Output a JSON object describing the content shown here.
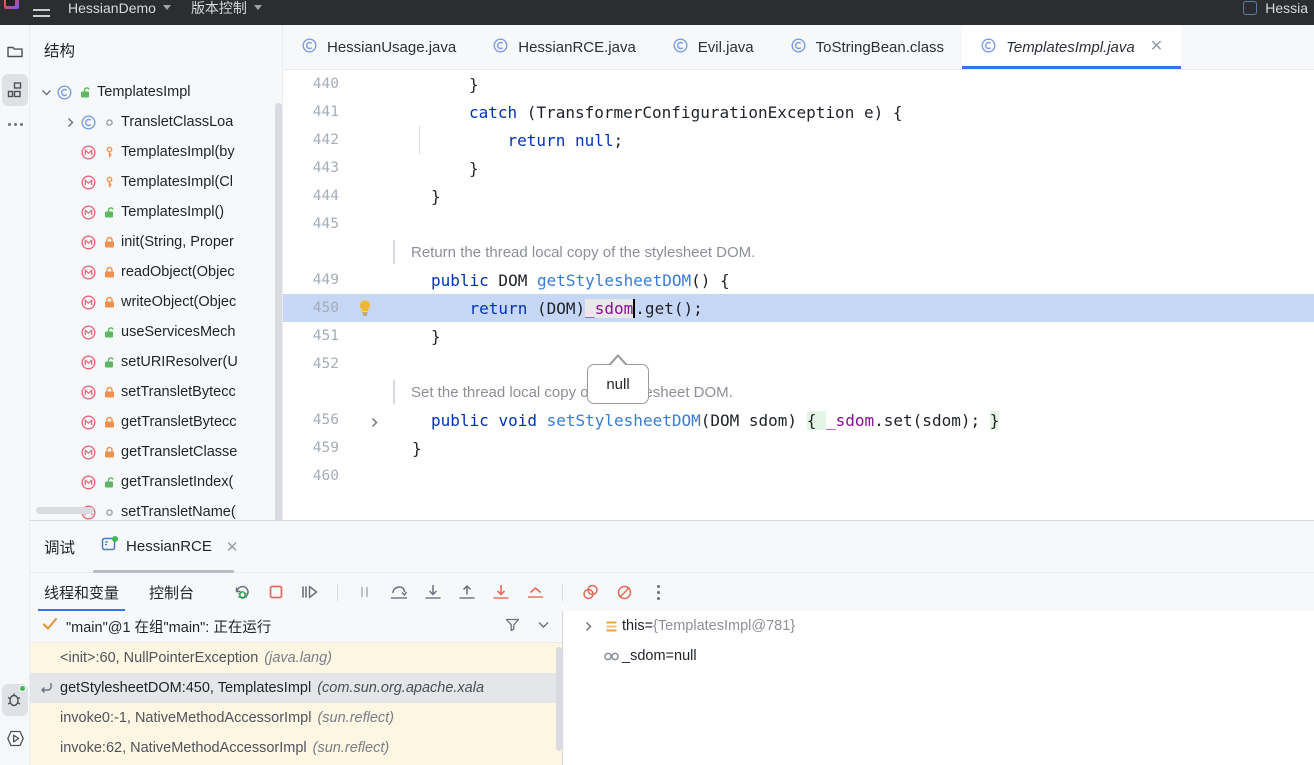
{
  "titlebar": {
    "menu_icon": "hamburger-menu-icon",
    "project_name": "HessianDemo",
    "vcs_label": "版本控制",
    "run_config": "Hessia"
  },
  "rail": {
    "project_icon": "folder-icon",
    "structure_icon": "structure-icon",
    "more_icon": "more-dots-icon",
    "debug_icon": "debug-bug-icon",
    "run_icon": "run-play-icon"
  },
  "structure": {
    "title": "结构",
    "items": [
      {
        "label": "TemplatesImpl",
        "kind": "class",
        "visibility": "public",
        "indent": 0,
        "expanded": true,
        "has_arrow": true
      },
      {
        "label": "TransletClassLoa",
        "kind": "class",
        "visibility": "package",
        "indent": 1,
        "expanded": false,
        "has_arrow": true
      },
      {
        "label": "TemplatesImpl(by",
        "kind": "method",
        "visibility": "protected",
        "indent": 1,
        "has_arrow": false
      },
      {
        "label": "TemplatesImpl(Cl",
        "kind": "method",
        "visibility": "protected",
        "indent": 1,
        "has_arrow": false
      },
      {
        "label": "TemplatesImpl()",
        "kind": "method",
        "visibility": "public",
        "indent": 1,
        "has_arrow": false
      },
      {
        "label": "init(String, Proper",
        "kind": "method",
        "visibility": "private",
        "indent": 1,
        "has_arrow": false
      },
      {
        "label": "readObject(Objec",
        "kind": "method",
        "visibility": "private",
        "indent": 1,
        "has_arrow": false
      },
      {
        "label": "writeObject(Objec",
        "kind": "method",
        "visibility": "private",
        "indent": 1,
        "has_arrow": false
      },
      {
        "label": "useServicesMech",
        "kind": "method",
        "visibility": "public",
        "indent": 1,
        "has_arrow": false
      },
      {
        "label": "setURIResolver(U",
        "kind": "method",
        "visibility": "public",
        "indent": 1,
        "has_arrow": false
      },
      {
        "label": "setTransletBytecc",
        "kind": "method",
        "visibility": "private",
        "indent": 1,
        "has_arrow": false
      },
      {
        "label": "getTransletBytecc",
        "kind": "method",
        "visibility": "private",
        "indent": 1,
        "has_arrow": false
      },
      {
        "label": "getTransletClasse",
        "kind": "method",
        "visibility": "private",
        "indent": 1,
        "has_arrow": false
      },
      {
        "label": "getTransletIndex(",
        "kind": "method",
        "visibility": "public",
        "indent": 1,
        "has_arrow": false
      },
      {
        "label": "setTransletName(",
        "kind": "method",
        "visibility": "package",
        "indent": 1,
        "has_arrow": false
      }
    ]
  },
  "editor_tabs": [
    {
      "label": "HessianUsage.java",
      "icon": "java-class-icon",
      "active": false,
      "closable": false
    },
    {
      "label": "HessianRCE.java",
      "icon": "java-class-icon",
      "active": false,
      "closable": false
    },
    {
      "label": "Evil.java",
      "icon": "java-class-icon",
      "active": false,
      "closable": false
    },
    {
      "label": "ToStringBean.class",
      "icon": "java-class-icon",
      "active": false,
      "closable": false
    },
    {
      "label": "TemplatesImpl.java",
      "icon": "java-class-icon",
      "active": true,
      "closable": true
    }
  ],
  "code": {
    "lines": [
      {
        "num": "440",
        "type": "code",
        "indent": 4,
        "tokens": [
          {
            "t": "}",
            "c": "plain"
          }
        ]
      },
      {
        "num": "441",
        "type": "code",
        "indent": 4,
        "tokens": [
          {
            "t": "catch",
            "c": "kw"
          },
          {
            "t": " (TransformerConfigurationException e) {",
            "c": "plain"
          }
        ]
      },
      {
        "num": "442",
        "type": "code",
        "indent": 4,
        "guide": true,
        "tokens": [
          {
            "t": "    ",
            "c": "plain"
          },
          {
            "t": "return",
            "c": "kw"
          },
          {
            "t": " ",
            "c": "plain"
          },
          {
            "t": "null",
            "c": "kw"
          },
          {
            "t": ";",
            "c": "plain"
          }
        ]
      },
      {
        "num": "443",
        "type": "code",
        "indent": 4,
        "tokens": [
          {
            "t": "}",
            "c": "plain"
          }
        ]
      },
      {
        "num": "444",
        "type": "code",
        "indent": 2,
        "tokens": [
          {
            "t": "}",
            "c": "plain"
          }
        ]
      },
      {
        "num": "445",
        "type": "code",
        "indent": 0,
        "tokens": []
      },
      {
        "num": "",
        "type": "doc",
        "text": "Return the thread local copy of the stylesheet DOM."
      },
      {
        "num": "449",
        "type": "code",
        "indent": 2,
        "tokens": [
          {
            "t": "public",
            "c": "kw"
          },
          {
            "t": " DOM ",
            "c": "plain"
          },
          {
            "t": "getStylesheetDOM",
            "c": "mth"
          },
          {
            "t": "() {",
            "c": "plain"
          }
        ]
      },
      {
        "num": "450",
        "type": "code",
        "indent": 2,
        "selected": true,
        "bulb": true,
        "tokens": [
          {
            "t": "    ",
            "c": "plain"
          },
          {
            "t": "return",
            "c": "kw"
          },
          {
            "t": " (DOM)",
            "c": "plain"
          },
          {
            "t": "_sdom",
            "c": "fldbg"
          },
          {
            "t": "|",
            "c": "caret"
          },
          {
            "t": ".get();",
            "c": "plain"
          }
        ]
      },
      {
        "num": "451",
        "type": "code",
        "indent": 2,
        "tokens": [
          {
            "t": "}",
            "c": "plain"
          }
        ]
      },
      {
        "num": "452",
        "type": "code",
        "indent": 0,
        "tokens": []
      },
      {
        "num": "",
        "type": "doc",
        "text": "Set the thread local copy of the stylesheet DOM."
      },
      {
        "num": "456",
        "type": "code",
        "indent": 2,
        "fold": true,
        "tokens": [
          {
            "t": "public",
            "c": "kw"
          },
          {
            "t": " ",
            "c": "plain"
          },
          {
            "t": "void",
            "c": "kw"
          },
          {
            "t": " ",
            "c": "plain"
          },
          {
            "t": "setStylesheetDOM",
            "c": "mth"
          },
          {
            "t": "(DOM sdom) ",
            "c": "plain"
          },
          {
            "t": "{ ",
            "c": "green"
          },
          {
            "t": "_sdom",
            "c": "fld"
          },
          {
            "t": ".set(sdom); ",
            "c": "plain"
          },
          {
            "t": "}",
            "c": "green"
          }
        ]
      },
      {
        "num": "459",
        "type": "code",
        "indent": 1,
        "tokens": [
          {
            "t": "}",
            "c": "plain"
          }
        ]
      },
      {
        "num": "460",
        "type": "code",
        "indent": 0,
        "tokens": []
      }
    ],
    "tooltip": "null"
  },
  "debug": {
    "title": "调试",
    "session_tab": "HessianRCE",
    "session_icon": "debug-session-icon",
    "close_icon": "close-icon",
    "sub_tabs": [
      {
        "label": "线程和变量",
        "active": true
      },
      {
        "label": "控制台",
        "active": false
      }
    ],
    "toolbar": [
      {
        "name": "rerun-debug-icon"
      },
      {
        "name": "stop-icon"
      },
      {
        "name": "resume-program-icon"
      },
      {
        "name": "pause-program-icon"
      },
      {
        "name": "step-over-icon"
      },
      {
        "name": "step-into-icon"
      },
      {
        "name": "step-out-icon"
      },
      {
        "name": "force-step-into-icon"
      },
      {
        "name": "run-to-cursor-icon"
      },
      {
        "name": "view-breakpoints-icon"
      },
      {
        "name": "mute-breakpoints-icon"
      },
      {
        "name": "more-options-icon"
      }
    ],
    "thread": {
      "status_icon": "thread-running-check-icon",
      "label": "\"main\"@1 在组\"main\": 正在运行",
      "filter_icon": "filter-icon",
      "chevron_icon": "chevron-down-icon"
    },
    "frames": [
      {
        "method": "<init>:60, NullPointerException",
        "package": "(java.lang)",
        "current": false
      },
      {
        "method": "getStylesheetDOM:450, TemplatesImpl",
        "package": "(com.sun.org.apache.xala",
        "current": true
      },
      {
        "method": "invoke0:-1, NativeMethodAccessorImpl",
        "package": "(sun.reflect)",
        "current": false
      },
      {
        "method": "invoke:62, NativeMethodAccessorImpl",
        "package": "(sun.reflect)",
        "current": false
      }
    ],
    "variables": [
      {
        "name": "this",
        "value": "{TemplatesImpl@781}",
        "icon": "object-value-icon",
        "expandable": true,
        "indent": 0
      },
      {
        "name": "_sdom",
        "value": "null",
        "icon": "field-watch-icon",
        "expandable": false,
        "indent": 0
      }
    ]
  },
  "colors": {
    "accent_blue": "#3574f0",
    "keyword_blue": "#0033b3",
    "field_purple": "#871094",
    "method_blue": "#3a7bd5",
    "selection_blue": "#c6d7f5",
    "frames_bg": "#fdf6e3",
    "panel_bg": "#f7f8fa",
    "titlebar_bg": "#2b2d30"
  }
}
